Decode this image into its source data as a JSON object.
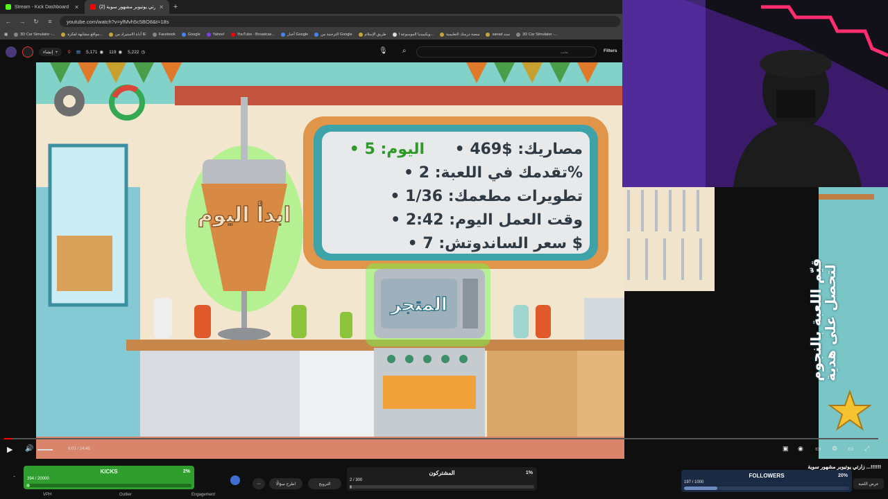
{
  "browser": {
    "tabs": [
      {
        "title": "Stream - Kick Dashboard",
        "color": "#53fc18"
      },
      {
        "title": "(2) زارتي يوتيوبر مشهور سوية",
        "color": "#ff0000"
      }
    ],
    "url": "youtube.com/watch?v=yfMvh5c5BO8&t=18s",
    "bookmarks": [
      "3D Car Simulator -...",
      "مواقع مشابهة لفكرة...",
      "أداة الاستيراد من IE",
      "Facebook",
      "Google",
      "Yahoo!",
      "YouTube - Broadcas...",
      "أخبار Google",
      "الترجمة من Google",
      "طريق الإسلام",
      "ويكيبيديا الموسوعة ا...",
      "منصة درسك التعليمية",
      "sanad سند",
      "3D Car Simulator -..."
    ]
  },
  "toolbar": {
    "create_label": "إنشاء",
    "stats": [
      "5,171",
      "119",
      "5,222"
    ],
    "search_placeholder": "بحث",
    "filters_label": "Filters"
  },
  "game_board": {
    "line1": "• مصاريك: $469",
    "line1b": "• اليوم: 5",
    "line2": "• تقدمك في اللعبة: 2%",
    "line3": "• تطويرات مطعمك: 1/36",
    "line4": "• وقت العمل اليوم: 2:42",
    "line5": "• سعر الساندوتش: 7 $"
  },
  "shawarma_label": "ابدأ اليوم",
  "store_label": "المتجر",
  "side_text": "قيّم اللعبة بالنجوم لتحصل على هدية",
  "player": {
    "time": "0:03 / 24:46",
    "progress": 0.002
  },
  "video_title": "زارتي يوتيوبر مشهور سوية ...!!!!!!",
  "bottom": {
    "kicks": {
      "label": "KICKS",
      "count": "394 / 20000",
      "percent": "2%",
      "fraction": 0.02
    },
    "subs": {
      "label": "المشتركون",
      "count": "2 / 300",
      "percent": "1%",
      "fraction": 0.01
    },
    "followers": {
      "label": "FOLLOWERS",
      "count": "197 / 1000",
      "percent": "20%",
      "fraction": 0.2
    },
    "vph": "VPH",
    "outlier": "Outlier",
    "engagement": "Engagement",
    "ask_label": "اطرح سؤالًا",
    "promote_label": "الترويج",
    "clip_label": "عرض اللعبة"
  },
  "colors": {
    "kick_green": "#2f9e2f",
    "yt_red": "#ff0000",
    "board_text": "#2f3a44",
    "board_value": "#2e9a2a"
  }
}
